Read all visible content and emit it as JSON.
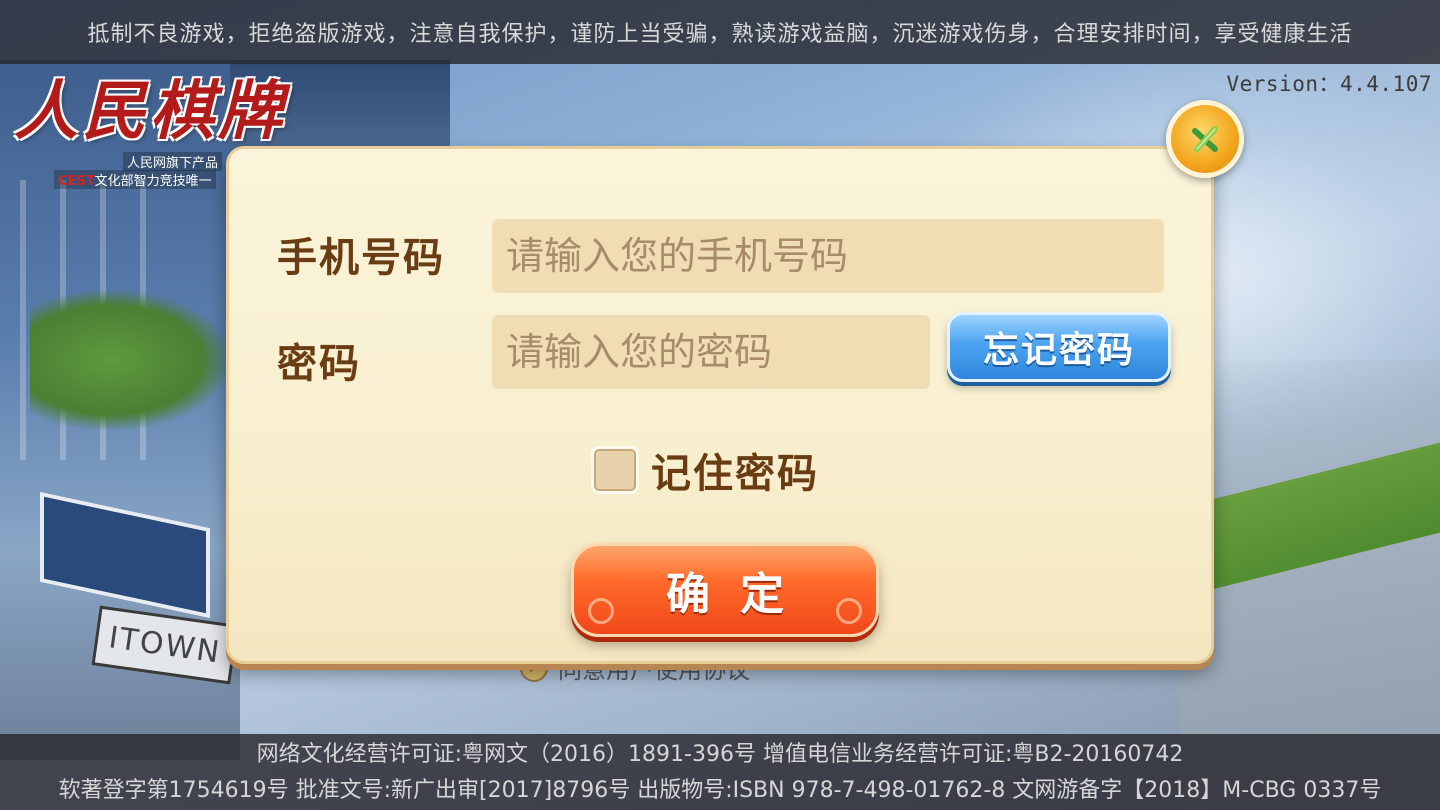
{
  "notice": {
    "text": "抵制不良游戏，拒绝盗版游戏，注意自我保护，谨防上当受骗，熟读游戏益脑，沉迷游戏伤身，合理安排时间，享受健康生活"
  },
  "version": "Version：4.4.107",
  "logo": {
    "title": "人民棋牌",
    "subtitle1": "人民网旗下产品",
    "subtitle2_prefix": "CEST",
    "subtitle2": "文化部智力竞技唯一"
  },
  "login": {
    "phone_label": "手机号码",
    "phone_placeholder": "请输入您的手机号码",
    "phone_value": "",
    "password_label": "密码",
    "password_placeholder": "请输入您的密码",
    "password_value": "",
    "forgot_label": "忘记密码",
    "remember_label": "记住密码",
    "remember_checked": false,
    "confirm_label": "确定"
  },
  "agreement": {
    "text": "同意用户使用协议"
  },
  "background": {
    "sign_text": "ITOWN"
  },
  "license": {
    "line1": "网络文化经营许可证:粤网文（2016）1891-396号 增值电信业务经营许可证:粤B2-20160742",
    "line2": "软著登字第1754619号 批准文号:新广出审[2017]8796号 出版物号:ISBN 978-7-498-01762-8 文网游备字【2018】M-CBG 0337号"
  },
  "colors": {
    "dialog_bg": "#f8efcf",
    "label_brown": "#6a3c14",
    "forgot_blue": "#4aa3f2",
    "confirm_orange": "#ff6a2a",
    "close_gold": "#f2a51c",
    "logo_red": "#b31a1a"
  },
  "icons": {
    "close": "close-icon",
    "checkbox": "checkbox-icon"
  }
}
